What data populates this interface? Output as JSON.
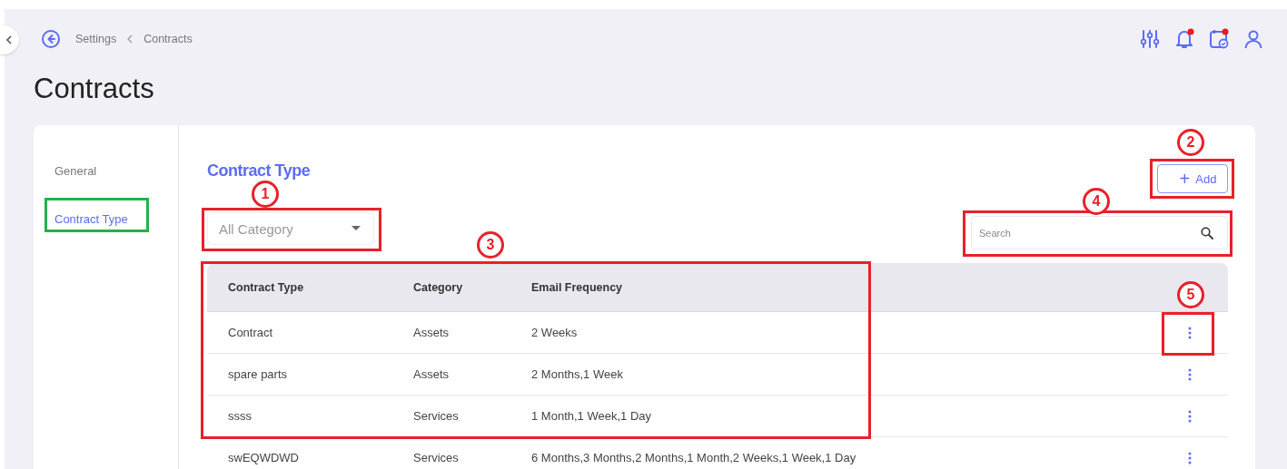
{
  "breadcrumb": [
    {
      "label": "Settings"
    },
    {
      "label": "Contracts"
    }
  ],
  "header_icons": [
    {
      "kind": "sliders",
      "badge": false
    },
    {
      "kind": "bell",
      "badge": true
    },
    {
      "kind": "calendar",
      "badge": true
    },
    {
      "kind": "user",
      "badge": false
    }
  ],
  "page_title": "Contracts",
  "sidebar": {
    "items": [
      {
        "label": "General",
        "selected": false
      },
      {
        "label": "Contract Type",
        "selected": true
      }
    ]
  },
  "section_title": "Contract Type",
  "add_button": {
    "icon": "+",
    "label": "Add"
  },
  "category_filter": {
    "placeholder": "All Category"
  },
  "search": {
    "placeholder": "Search"
  },
  "table": {
    "columns": [
      "Contract Type",
      "Category",
      "Email Frequency"
    ],
    "rows": [
      {
        "cells": [
          "Contract",
          "Assets",
          "2 Weeks"
        ]
      },
      {
        "cells": [
          "spare parts",
          "Assets",
          "2 Months,1 Week"
        ]
      },
      {
        "cells": [
          "ssss",
          "Services",
          "1 Month,1 Week,1 Day"
        ]
      },
      {
        "cells": [
          "swEQWDWD",
          "Services",
          "6 Months,3 Months,2 Months,1 Month,2 Weeks,1 Week,1 Day"
        ]
      }
    ]
  },
  "annotations": [
    {
      "label": "1",
      "color": "#e8202a"
    },
    {
      "label": "2",
      "color": "#e8202a"
    },
    {
      "label": "3",
      "color": "#e8202a"
    },
    {
      "label": "4",
      "color": "#e8202a"
    },
    {
      "label": "5",
      "color": "#e8202a"
    },
    {
      "color": "#22b14c"
    }
  ]
}
